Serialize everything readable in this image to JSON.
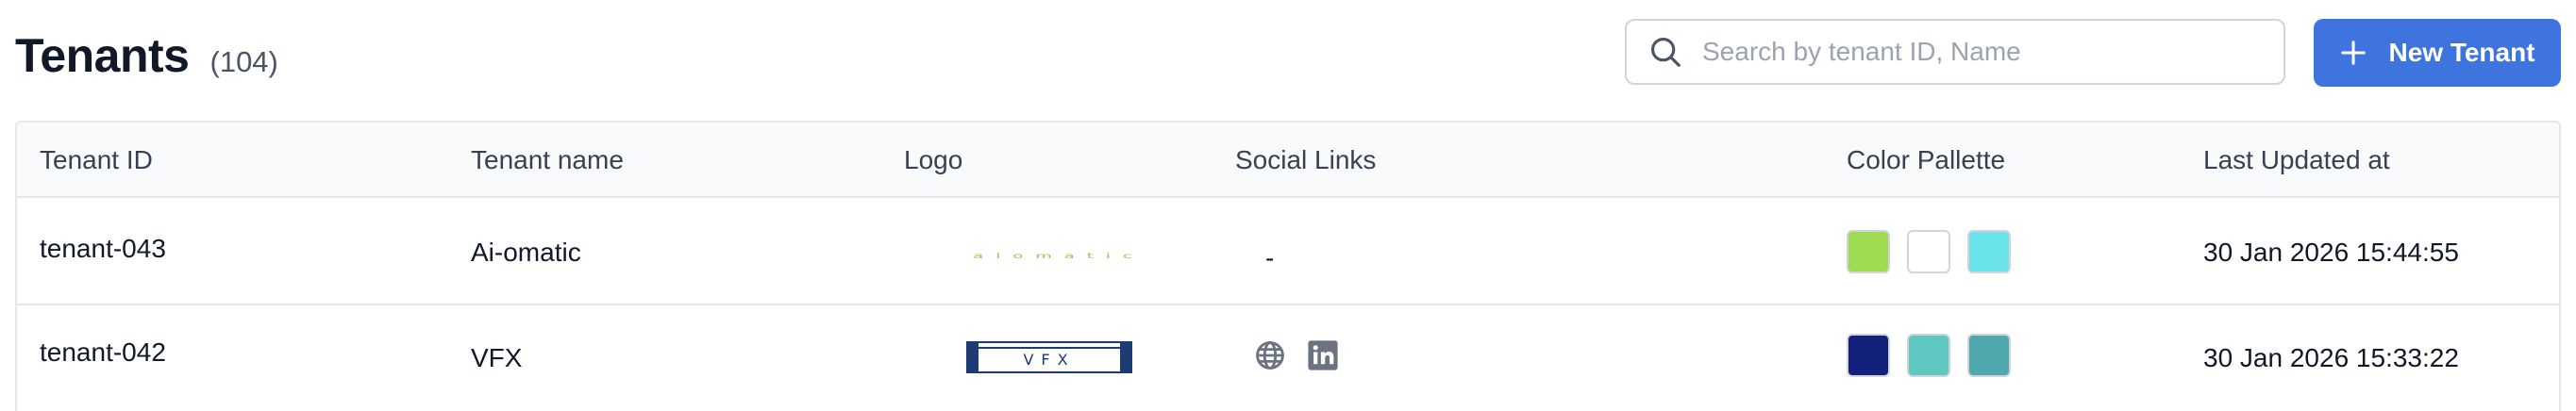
{
  "header": {
    "title": "Tenants",
    "count": "(104)",
    "search_placeholder": "Search by tenant ID, Name",
    "new_button_label": "New Tenant"
  },
  "table": {
    "columns": [
      "Tenant ID",
      "Tenant name",
      "Logo",
      "Social Links",
      "Color Pallette",
      "Last Updated at"
    ],
    "rows": [
      {
        "id": "tenant-043",
        "name": "Ai-omatic",
        "logo_text": "aiomatic",
        "social": "-",
        "colors": [
          "#9ddc4f",
          "#ffffff",
          "#6be3ea"
        ],
        "updated": "30 Jan 2026 15:44:55"
      },
      {
        "id": "tenant-042",
        "name": "VFX",
        "logo_text": "VFX",
        "social_icons": [
          "globe-icon",
          "linkedin-icon"
        ],
        "colors": [
          "#12207a",
          "#5ec8c0",
          "#4ea8ae"
        ],
        "updated": "30 Jan 2026 15:33:22"
      }
    ]
  },
  "colors": {
    "accent": "#3f74de",
    "header_bg": "#f8fafc",
    "border": "#e5e7eb"
  }
}
